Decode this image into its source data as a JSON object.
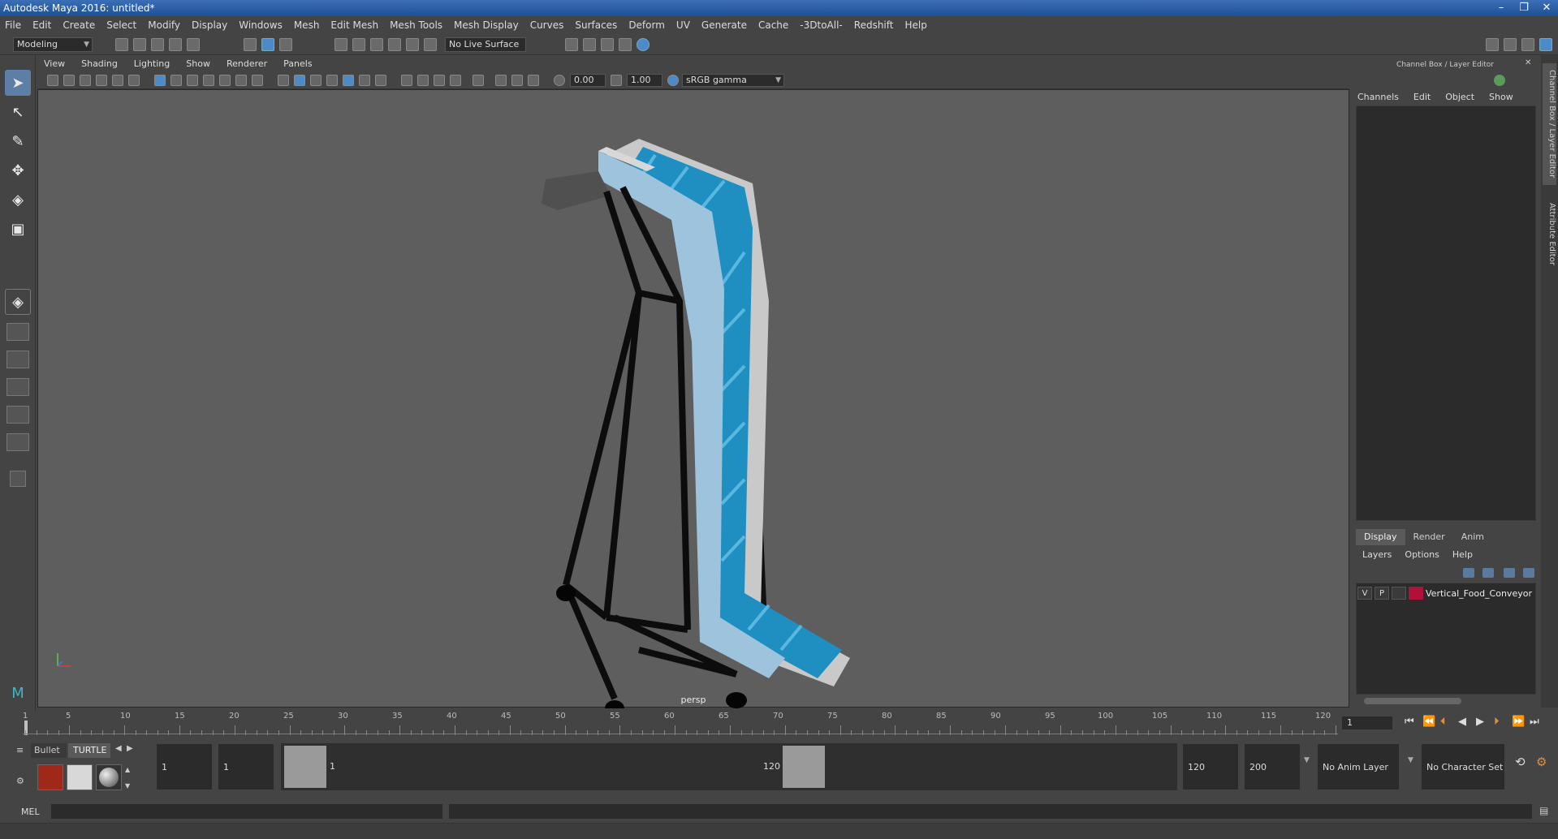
{
  "window": {
    "title": "Autodesk Maya 2016: untitled*"
  },
  "menubar": [
    "File",
    "Edit",
    "Create",
    "Select",
    "Modify",
    "Display",
    "Windows",
    "Mesh",
    "Edit Mesh",
    "Mesh Tools",
    "Mesh Display",
    "Curves",
    "Surfaces",
    "Deform",
    "UV",
    "Generate",
    "Cache",
    "-3DtoAll-",
    "Redshift",
    "Help"
  ],
  "shelf": {
    "mode": "Modeling",
    "live_surface": "No Live Surface"
  },
  "viewport": {
    "menu": [
      "View",
      "Shading",
      "Lighting",
      "Show",
      "Renderer",
      "Panels"
    ],
    "exposure": "0.00",
    "gamma": "1.00",
    "color_space": "sRGB gamma",
    "camera_label": "persp"
  },
  "channel_box": {
    "header": "Channel Box / Layer Editor",
    "menu": [
      "Channels",
      "Edit",
      "Object",
      "Show"
    ]
  },
  "layer_editor": {
    "tabs": [
      "Display",
      "Render",
      "Anim"
    ],
    "selected_tab": "Display",
    "menu": [
      "Layers",
      "Options",
      "Help"
    ],
    "layers": [
      {
        "visible": "V",
        "playback": "P",
        "color": "#b0103a",
        "name": "Vertical_Food_Conveyor"
      }
    ]
  },
  "side_tabs": [
    "Channel Box / Layer Editor",
    "Attribute Editor"
  ],
  "timeline": {
    "current_frame_label": "1",
    "ticks": [
      "5",
      "10",
      "15",
      "20",
      "25",
      "30",
      "35",
      "40",
      "45",
      "50",
      "55",
      "60",
      "65",
      "70",
      "75",
      "80",
      "85",
      "90",
      "95",
      "100",
      "105",
      "110",
      "115",
      "120"
    ],
    "current_frame_field": "1"
  },
  "range": {
    "shelf_tabs": [
      "Bullet",
      "TURTLE"
    ],
    "start": "1",
    "playback_start": "1",
    "slider_start": "1",
    "slider_end": "120",
    "playback_end": "120",
    "end": "200",
    "anim_layer": "No Anim Layer",
    "character_set": "No Character Set"
  },
  "command_line": {
    "label": "MEL"
  }
}
